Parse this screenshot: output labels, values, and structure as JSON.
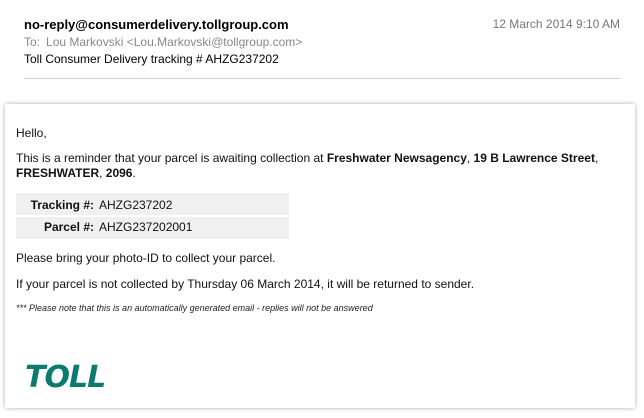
{
  "email": {
    "from": "no-reply@consumerdelivery.tollgroup.com",
    "date": "12 March 2014 9:10 AM",
    "to_label": "To:",
    "to": "Lou Markovski <Lou.Markovski@tollgroup.com>",
    "subject": "Toll Consumer Delivery tracking # AHZG237202"
  },
  "message": {
    "greeting": "Hello,",
    "reminder_intro": "This is a reminder that your parcel is awaiting collection at ",
    "location_name": "Freshwater Newsagency",
    "comma1": ", ",
    "street": "19 B Lawrence Street",
    "comma2": ", ",
    "suburb": "FRESHWATER",
    "comma3": ", ",
    "postcode": "2096",
    "period": ".",
    "tracking_label": "Tracking #:",
    "tracking_value": "AHZG237202",
    "parcel_label": "Parcel #:",
    "parcel_value": "AHZG237202001",
    "bring_id": "Please bring your photo-ID to collect your parcel.",
    "not_collected": "If your parcel is not collected by Thursday 06 March 2014, it will be returned to sender.",
    "auto_note": "*** Please note that this is an automatically generated email - replies will not be answered"
  },
  "logo": {
    "text": "TOLL",
    "color": "#0b7b6e"
  }
}
